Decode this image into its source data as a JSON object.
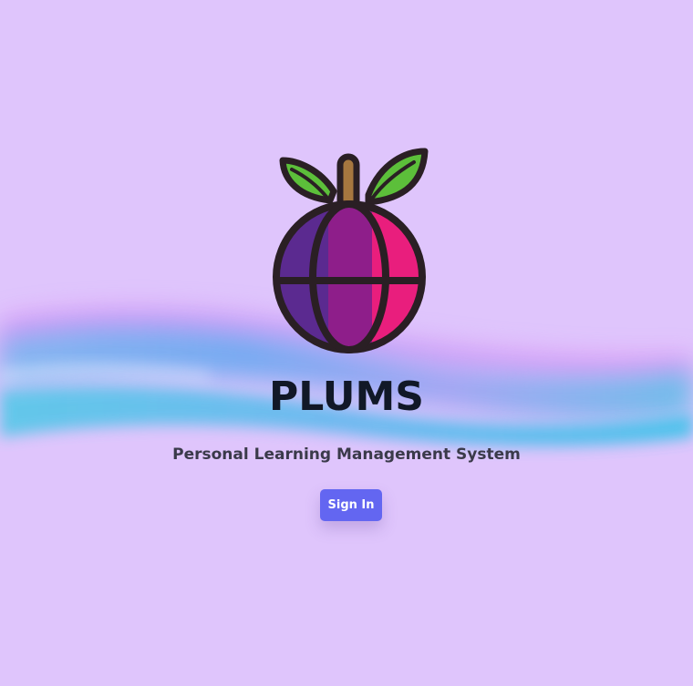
{
  "app": {
    "title": "PLUMS",
    "subtitle": "Personal Learning Management System"
  },
  "actions": {
    "sign_in_label": "Sign In"
  },
  "logo": {
    "icon": "plum-logo-icon"
  },
  "colors": {
    "background": "#dfc5fc",
    "button": "#6366f1",
    "title": "#111827",
    "plum_left": "#5b2a90",
    "plum_middle": "#8e1e8a",
    "plum_right": "#e91e7d",
    "leaf": "#5cbf3a",
    "stem": "#a6773f",
    "outline": "#2a1f24"
  }
}
